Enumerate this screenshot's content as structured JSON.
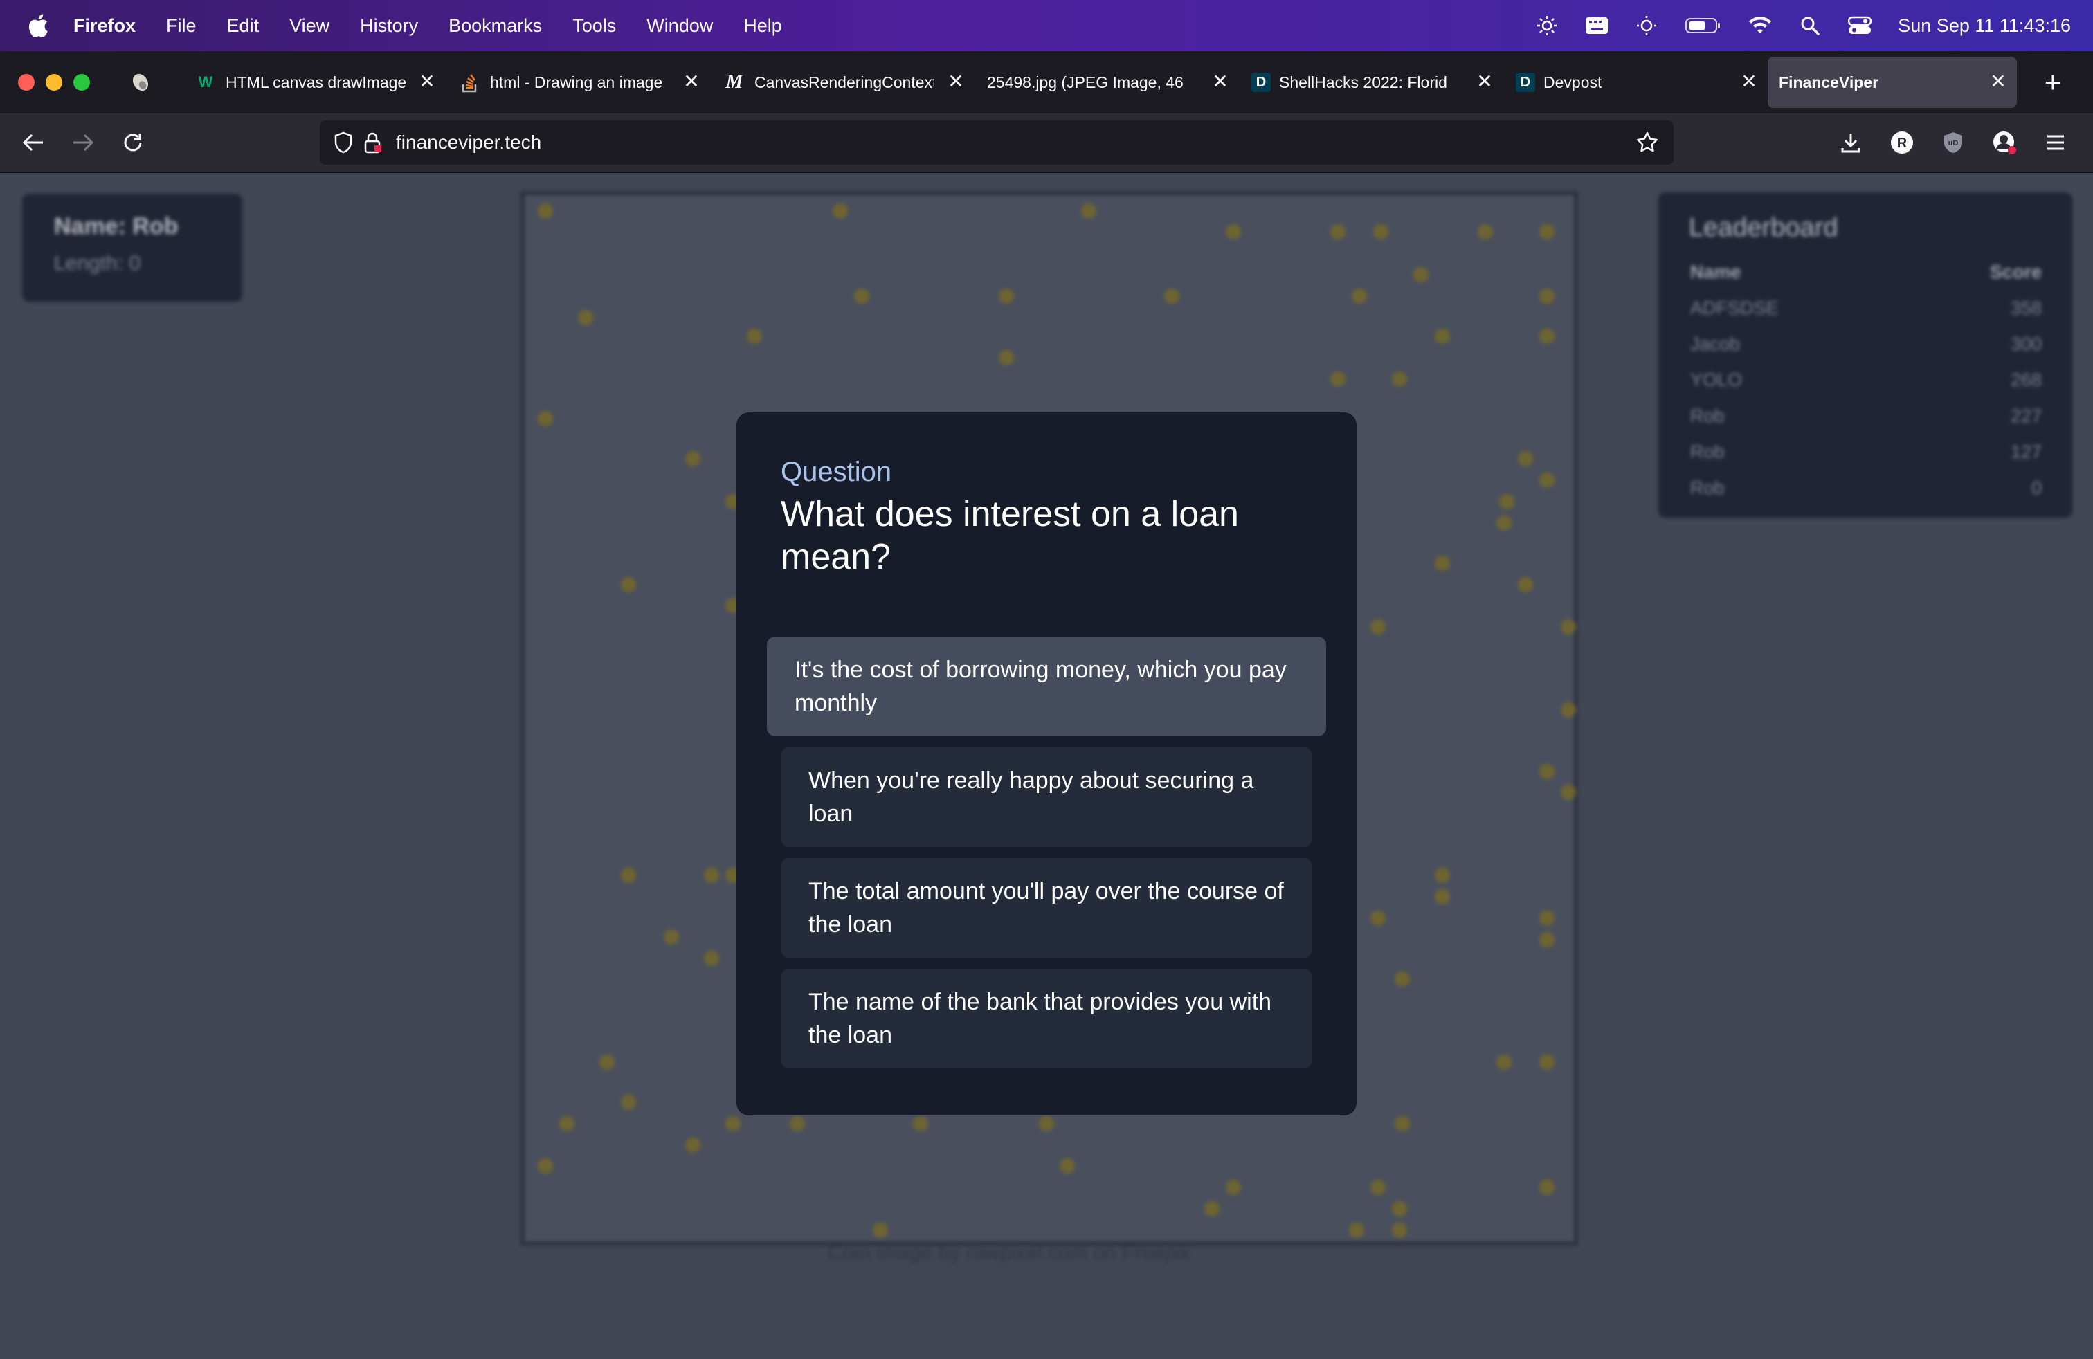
{
  "menubar": {
    "app_name": "Firefox",
    "items": [
      "File",
      "Edit",
      "View",
      "History",
      "Bookmarks",
      "Tools",
      "Window",
      "Help"
    ],
    "clock": "Sun Sep 11  11:43:16"
  },
  "tabs": [
    {
      "title": "",
      "icon": "pin-tab-icon"
    },
    {
      "title": "HTML canvas drawImage",
      "icon": "w3schools-icon",
      "favicon_text": "W"
    },
    {
      "title": "html - Drawing an image",
      "icon": "stackoverflow-icon"
    },
    {
      "title": "CanvasRenderingContext",
      "icon": "mdn-icon",
      "favicon_text": "M"
    },
    {
      "title": "25498.jpg (JPEG Image, 46",
      "icon": "image-icon"
    },
    {
      "title": "ShellHacks 2022: Florid",
      "icon": "devpost-icon",
      "favicon_text": "D"
    },
    {
      "title": "Devpost",
      "icon": "devpost-icon",
      "favicon_text": "D"
    },
    {
      "title": "FinanceViper",
      "icon": "none",
      "active": true
    }
  ],
  "navbar": {
    "url": "financeviper.tech"
  },
  "page": {
    "player": {
      "name": "Name: Rob",
      "length": "Length: 0"
    },
    "credit": "Coin image by rawpixel.com on Freepik",
    "leaderboard": {
      "title": "Leaderboard",
      "headers": [
        "Name",
        "Score"
      ],
      "rows": [
        {
          "name": "ADFSDSE",
          "score": "358"
        },
        {
          "name": "Jacob",
          "score": "300"
        },
        {
          "name": "YOLO",
          "score": "268"
        },
        {
          "name": "Rob",
          "score": "227"
        },
        {
          "name": "Rob",
          "score": "127"
        },
        {
          "name": "Rob",
          "score": "0"
        }
      ]
    }
  },
  "modal": {
    "label": "Question",
    "question": "What does interest on a loan mean?",
    "answers": [
      "It's the cost of borrowing money, which you pay monthly",
      "When you're really happy about securing a loan",
      "The total amount you'll pay over the course of the loan",
      "The name of the bank that provides you with the loan"
    ]
  },
  "colors": {
    "menubar_start": "#3a1b6b",
    "menubar_end": "#3b2aa8",
    "modal_bg": "#161c29",
    "answer_bg": "#242b3a",
    "answer_highlight": "#444c5e",
    "question_label": "#a9c3ec",
    "coin": "#8a7b2e"
  }
}
